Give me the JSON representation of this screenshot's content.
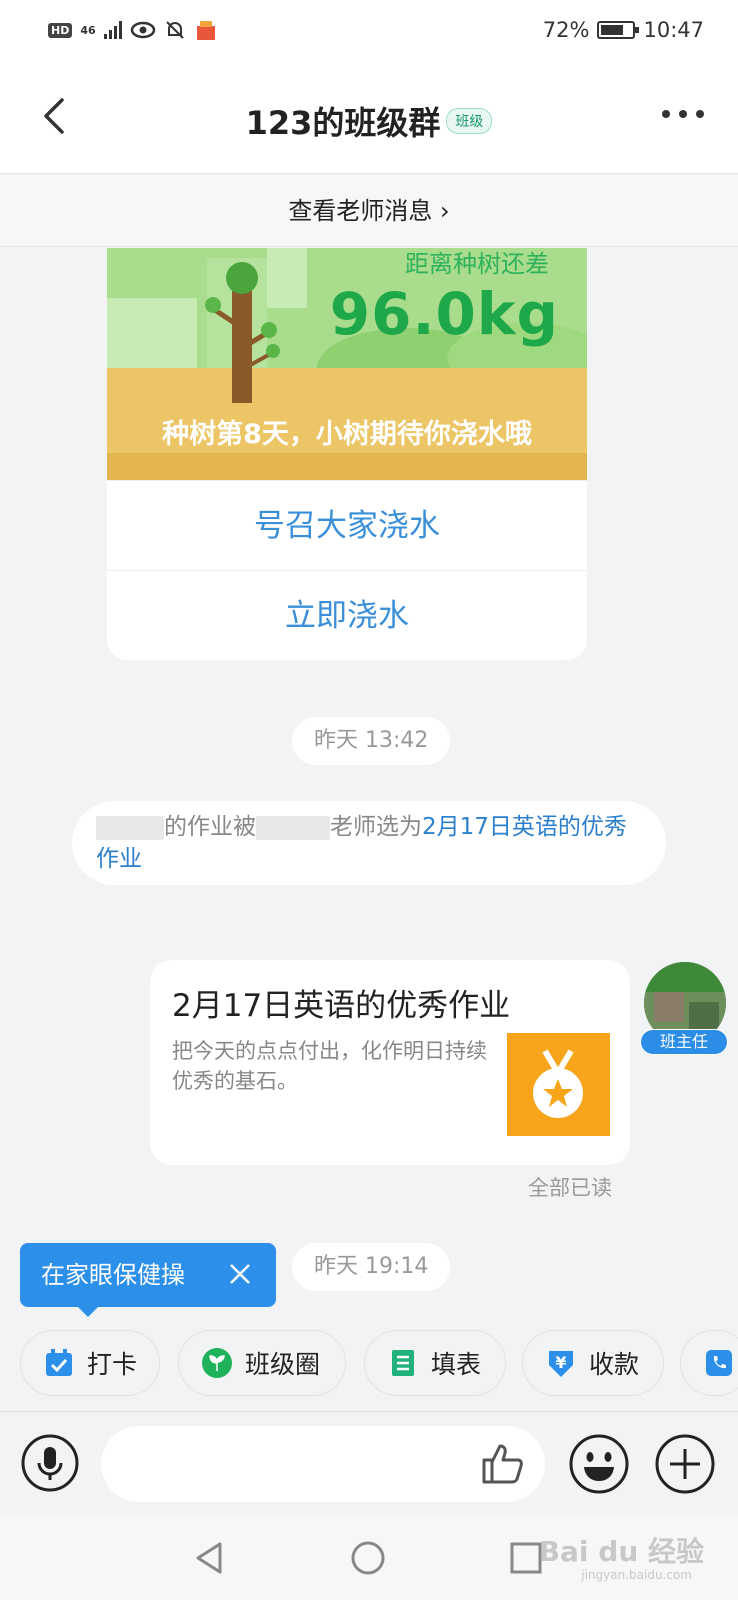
{
  "status_bar": {
    "hd": "HD",
    "network": "46",
    "battery_percent": "72%",
    "time": "10:47"
  },
  "header": {
    "title": "123的班级群",
    "badge": "班级"
  },
  "teacher_bar": {
    "label": "查看老师消息 ›"
  },
  "tree_card": {
    "remain_label": "距离种树还差",
    "remain_amount": "96.0kg",
    "day_text": "种树第8天，小树期待你浇水哦",
    "buttons": [
      "号召大家浇水",
      "立即浇水"
    ]
  },
  "timestamps": [
    "昨天 13:42",
    "昨天 19:14"
  ],
  "notice": {
    "text_1": "的作业被",
    "text_2": "老师选为",
    "link_text": "2月17日英语的优秀作业"
  },
  "homework_card": {
    "title": "2月17日英语的优秀作业",
    "description": "把今天的点点付出，化作明日持续优秀的基石。",
    "sender_role": "班主任",
    "read_status": "全部已读"
  },
  "tooltip": {
    "text": "在家眼保健操"
  },
  "tools": [
    {
      "label": "打卡",
      "icon": "calendar-check-icon",
      "color": "#2c8fea"
    },
    {
      "label": "班级圈",
      "icon": "sprout-icon",
      "color": "#1fb25b"
    },
    {
      "label": "填表",
      "icon": "form-icon",
      "color": "#1fb27a"
    },
    {
      "label": "收款",
      "icon": "yuan-shield-icon",
      "color": "#2c8fea"
    }
  ],
  "input_bar": {
    "placeholder": ""
  },
  "watermark": {
    "brand": "Bai du 经验",
    "url": "jingyan.baidu.com"
  },
  "colors": {
    "accent_blue": "#2c8fea",
    "link_blue": "#3b8fd9",
    "tree_green": "#1fa84a",
    "medal_orange": "#f8a51b"
  }
}
